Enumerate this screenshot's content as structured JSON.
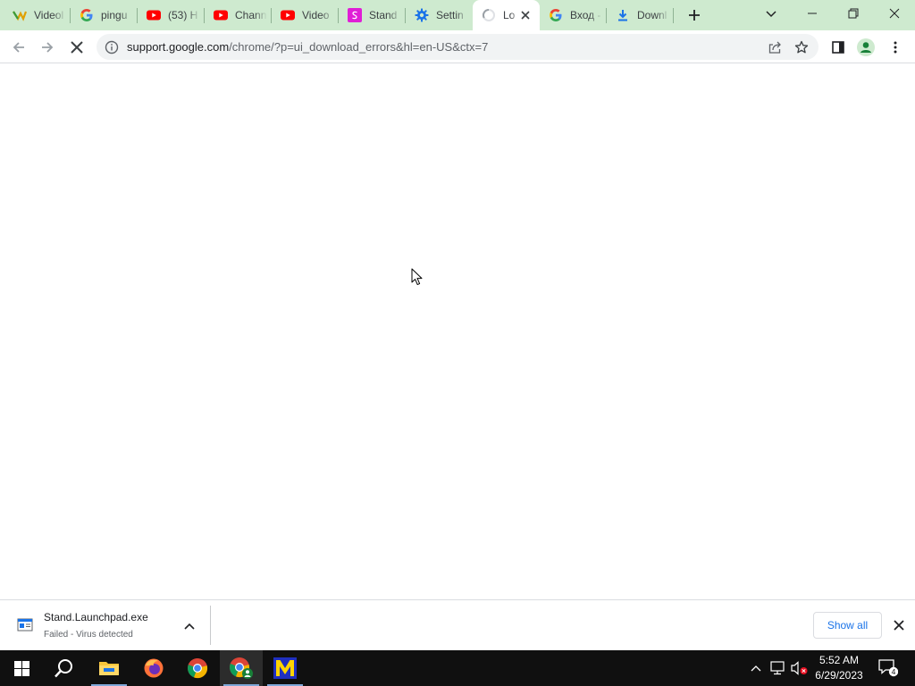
{
  "tabs": [
    {
      "title": "Videol",
      "icon": "video-app-icon"
    },
    {
      "title": "pingu",
      "icon": "google-icon"
    },
    {
      "title": "(53) H",
      "icon": "youtube-icon"
    },
    {
      "title": "Chann",
      "icon": "youtube-icon"
    },
    {
      "title": "Video",
      "icon": "youtube-icon"
    },
    {
      "title": "Stand",
      "icon": "stand-icon"
    },
    {
      "title": "Settin",
      "icon": "settings-gear-icon"
    },
    {
      "title": "Lo",
      "icon": "loading-spinner-icon",
      "active": true
    },
    {
      "title": "Вход -",
      "icon": "google-icon"
    },
    {
      "title": "Downl",
      "icon": "download-icon"
    }
  ],
  "address_bar": {
    "host": "support.google.com",
    "path": "/chrome/?p=ui_download_errors&hl=en-US&ctx=7"
  },
  "download_shelf": {
    "file_name": "Stand.Launchpad.exe",
    "status": "Failed - Virus detected",
    "show_all_label": "Show all"
  },
  "taskbar": {
    "time": "5:52 AM",
    "date": "6/29/2023",
    "notification_count": "4"
  },
  "colors": {
    "tab_strip": "#ceeacf",
    "accent": "#1a73e8",
    "taskbar": "#101010"
  }
}
